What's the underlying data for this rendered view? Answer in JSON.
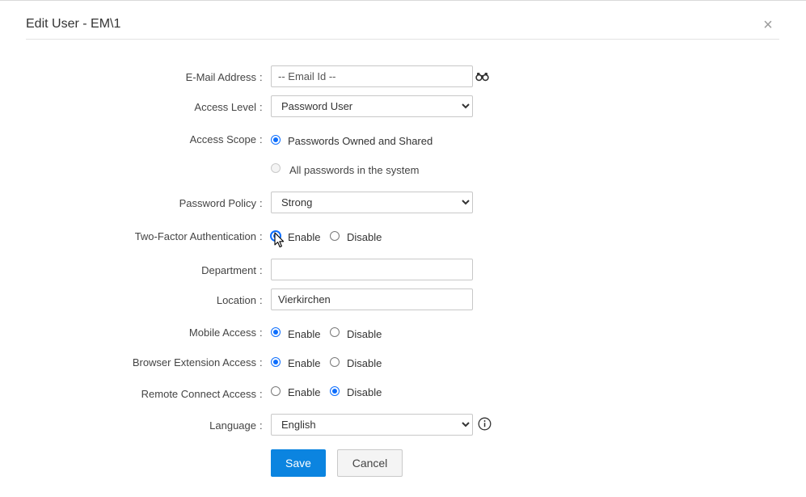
{
  "dialog": {
    "title": "Edit User - EM\\1",
    "close_glyph": "×"
  },
  "colors": {
    "accent": "#0b84e0",
    "radio_selected": "#0d6efd"
  },
  "form": {
    "email": {
      "label": "E-Mail Address",
      "colon": ":",
      "value": "",
      "placeholder": "-- Email Id --",
      "lookup_icon": "binoculars-icon"
    },
    "access_level": {
      "label": "Access Level",
      "colon": ":",
      "selected": "Password User"
    },
    "access_scope": {
      "label": "Access Scope",
      "colon": ":",
      "options": [
        {
          "label": "Passwords Owned and Shared",
          "checked": true,
          "disabled": false
        },
        {
          "label": "All passwords in the system",
          "checked": false,
          "disabled": true
        }
      ]
    },
    "password_policy": {
      "label": "Password Policy",
      "colon": ":",
      "selected": "Strong"
    },
    "two_factor": {
      "label": "Two-Factor Authentication",
      "colon": ":",
      "enable_label": "Enable",
      "disable_label": "Disable",
      "selected": "Enable"
    },
    "department": {
      "label": "Department",
      "colon": ":",
      "value": ""
    },
    "location": {
      "label": "Location",
      "colon": ":",
      "value": "Vierkirchen"
    },
    "mobile_access": {
      "label": "Mobile Access",
      "colon": ":",
      "enable_label": "Enable",
      "disable_label": "Disable",
      "selected": "Enable"
    },
    "browser_extension_access": {
      "label": "Browser Extension Access",
      "colon": ":",
      "enable_label": "Enable",
      "disable_label": "Disable",
      "selected": "Enable"
    },
    "remote_connect_access": {
      "label": "Remote Connect Access",
      "colon": ":",
      "enable_label": "Enable",
      "disable_label": "Disable",
      "selected": "Disable"
    },
    "language": {
      "label": "Language",
      "colon": ":",
      "selected": "English",
      "info_icon": "info-icon"
    }
  },
  "actions": {
    "save_label": "Save",
    "cancel_label": "Cancel"
  }
}
